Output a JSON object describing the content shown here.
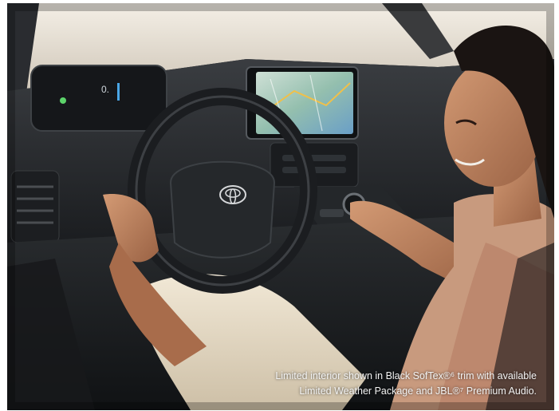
{
  "photo": {
    "subject_icon": "car-interior-photo",
    "brand_logo": "toyota-logo"
  },
  "caption": {
    "line1": "Limited interior shown in Black SofTex®⁶ trim with available",
    "line2": "Limited Weather Package and JBL®⁷ Premium Audio."
  },
  "colors": {
    "window_glare": "#e9e2d6",
    "dashboard": "#2a2d31",
    "screen_map": "#8fb7a8",
    "skin": "#b9825e",
    "pants": "#e8dcc6",
    "caption_text": "#f3f3f3"
  }
}
